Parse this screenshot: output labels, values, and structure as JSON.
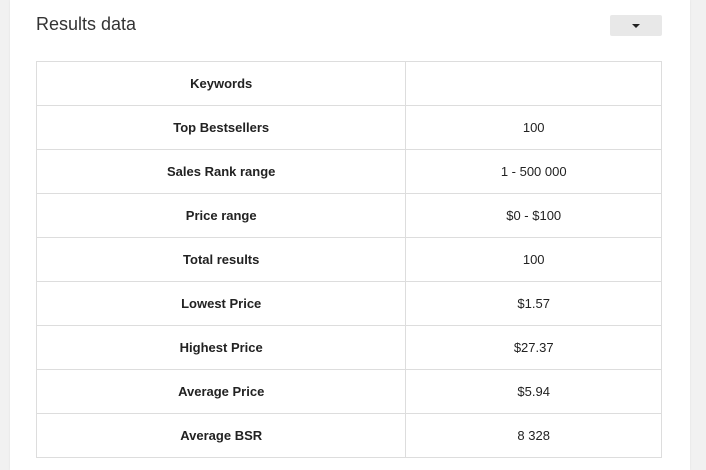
{
  "panel": {
    "title": "Results data"
  },
  "rows": [
    {
      "label": "Keywords",
      "value": ""
    },
    {
      "label": "Top Bestsellers",
      "value": "100"
    },
    {
      "label": "Sales Rank range",
      "value": "1 - 500 000"
    },
    {
      "label": "Price range",
      "value": "$0 - $100"
    },
    {
      "label": "Total results",
      "value": "100"
    },
    {
      "label": "Lowest Price",
      "value": "$1.57"
    },
    {
      "label": "Highest Price",
      "value": "$27.37"
    },
    {
      "label": "Average Price",
      "value": "$5.94"
    },
    {
      "label": "Average BSR",
      "value": "8 328"
    }
  ],
  "icons": {
    "dropdown": "caret-down-icon"
  },
  "colors": {
    "border": "#dddddd",
    "button_bg": "#e8e8e8",
    "text": "#222222"
  }
}
